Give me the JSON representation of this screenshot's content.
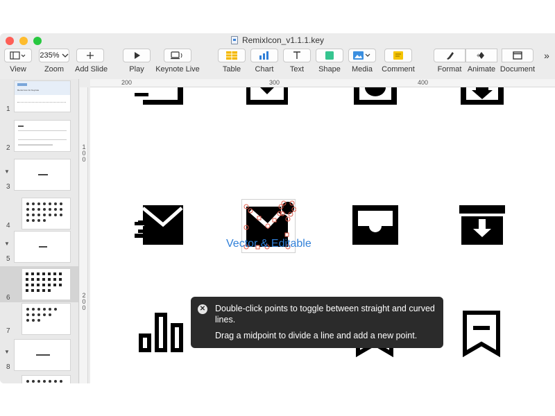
{
  "window": {
    "title": "RemixIcon_v1.1.1.key"
  },
  "toolbar": {
    "view_label": "View",
    "zoom_value": "235%",
    "zoom_label": "Zoom",
    "add_slide_label": "Add Slide",
    "play_label": "Play",
    "keynote_live_label": "Keynote Live",
    "table_label": "Table",
    "chart_label": "Chart",
    "text_label": "Text",
    "shape_label": "Shape",
    "media_label": "Media",
    "comment_label": "Comment",
    "format_label": "Format",
    "animate_label": "Animate",
    "document_label": "Document",
    "more_glyph": "»"
  },
  "sidebar": {
    "slides": [
      {
        "num": "1",
        "title": "Remix Icon for Keynote",
        "group": false,
        "selected": false
      },
      {
        "num": "2",
        "title": "",
        "group": false,
        "selected": false
      },
      {
        "num": "3",
        "title": "",
        "group": true,
        "selected": false
      },
      {
        "num": "4",
        "title": "",
        "group": false,
        "selected": false
      },
      {
        "num": "5",
        "title": "",
        "group": true,
        "selected": false
      },
      {
        "num": "6",
        "title": "",
        "group": false,
        "selected": true
      },
      {
        "num": "7",
        "title": "",
        "group": false,
        "selected": false
      },
      {
        "num": "8",
        "title": "",
        "group": true,
        "selected": false
      },
      {
        "num": "",
        "title": "",
        "group": false,
        "selected": false
      }
    ]
  },
  "rulers": {
    "top": [
      "200",
      "300",
      "400"
    ],
    "left": [
      "1\n0\n0",
      "2\n0\n0"
    ]
  },
  "canvas": {
    "caption": "Vector & Editable",
    "icons": [
      "mail-send-fill",
      "mail-edit-fill",
      "inbox-fill",
      "archive-fill",
      "bar-chart-line",
      "bar-chart-box-line",
      "bookmark-line",
      "bookmark-remove-line"
    ]
  },
  "tooltip": {
    "line1": "Double-click points to toggle between straight and curved lines.",
    "line2": "Drag a midpoint to divide a line and add a new point."
  },
  "colors": {
    "accent": "#2f7fd8",
    "close": "#fe5f57",
    "minimize": "#febc2e",
    "zoom": "#28c840",
    "edit_handles": "#e25b4a"
  }
}
